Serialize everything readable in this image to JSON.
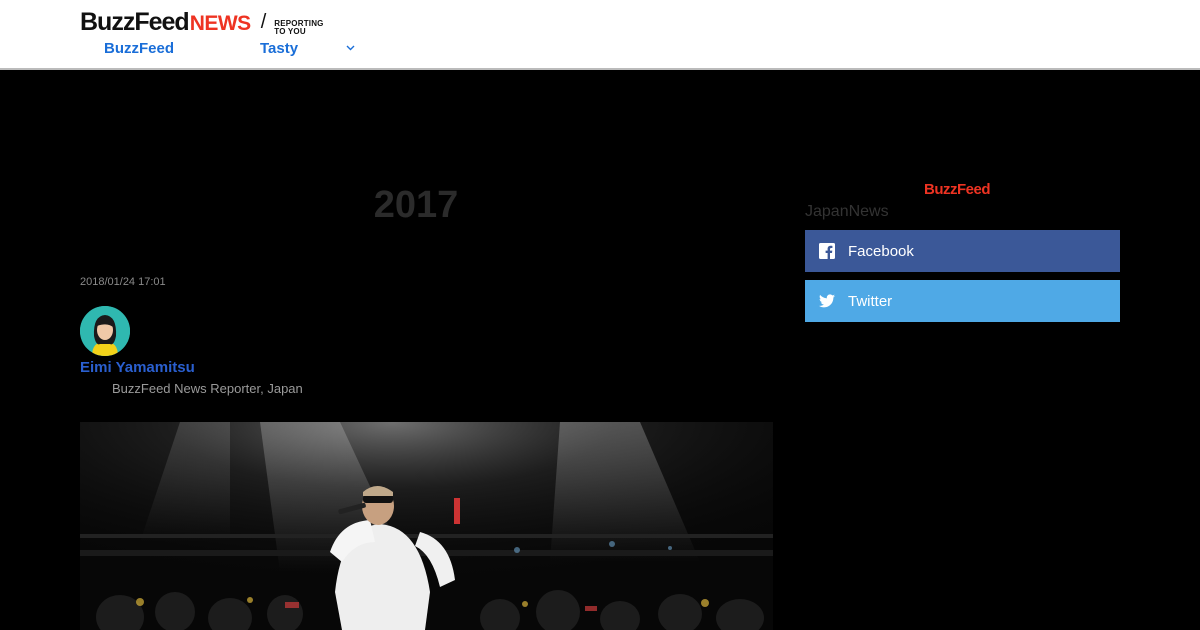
{
  "header": {
    "logo_main": "BuzzFeed",
    "logo_news": "NEWS",
    "tagline_line1": "REPORTING",
    "tagline_line2": "TO YOU",
    "nav": [
      {
        "label": "BuzzFeed"
      },
      {
        "label": "Tasty"
      }
    ]
  },
  "article": {
    "headline": "2017",
    "timestamp": "2018/01/24 17:01",
    "author_name": "Eimi Yamamitsu",
    "author_role": "BuzzFeed News Reporter, Japan"
  },
  "sidebar": {
    "logo": "BuzzFeed",
    "label": "JapanNews",
    "share": [
      {
        "label": "Facebook",
        "icon": "facebook-icon",
        "color": "#3b5898"
      },
      {
        "label": "Twitter",
        "icon": "twitter-icon",
        "color": "#4fa9e6"
      }
    ]
  },
  "colors": {
    "accent_blue": "#1a6ed8",
    "brand_red": "#e32222"
  }
}
